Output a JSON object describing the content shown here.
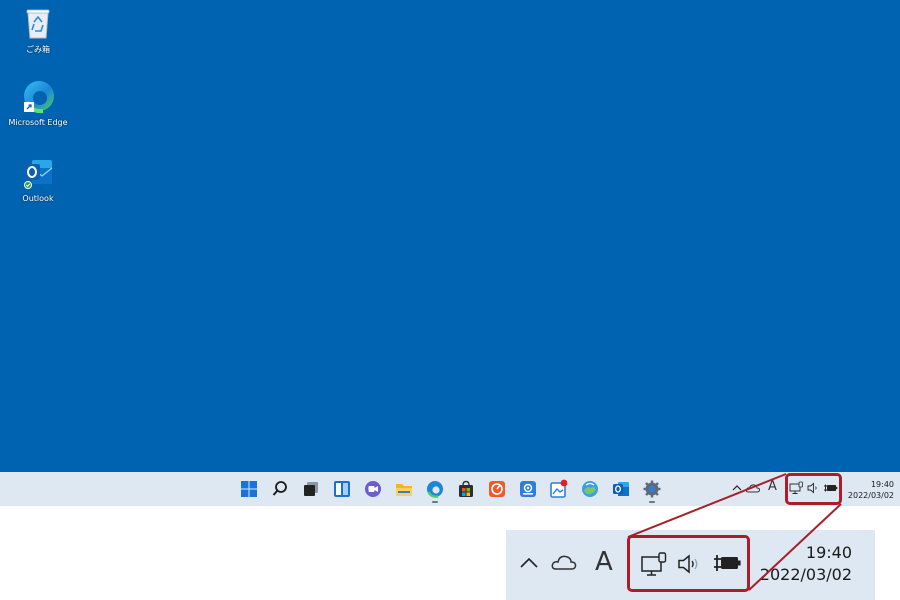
{
  "desktop": {
    "background": "#0063b1",
    "icons": [
      {
        "label": "ごみ箱",
        "icon": "recycle-bin-icon"
      },
      {
        "label": "Microsoft Edge",
        "icon": "edge-icon"
      },
      {
        "label": "Outlook",
        "icon": "outlook-icon"
      }
    ]
  },
  "taskbar": {
    "background": "#dde8f3",
    "pinned": [
      "start-icon",
      "search-icon",
      "task-view-icon",
      "widgets-icon",
      "teams-chat-icon",
      "file-explorer-icon",
      "edge-icon",
      "store-icon",
      "office-app-icon",
      "mail-app-icon",
      "photos-icon",
      "weather-icon",
      "outlook-icon",
      "settings-icon"
    ],
    "running": [
      "edge-icon",
      "settings-icon"
    ]
  },
  "tray": {
    "icons": [
      "chevron-up-icon",
      "onedrive-icon",
      "ime-icon",
      "network-icon",
      "volume-icon",
      "battery-icon"
    ],
    "ime_label": "A",
    "highlighted": [
      "network-icon",
      "volume-icon",
      "battery-icon"
    ],
    "time": "19:40",
    "date": "2022/03/02"
  },
  "callout": {
    "color": "#a81f2a",
    "zoom_panel_background": "#dde8f3"
  }
}
